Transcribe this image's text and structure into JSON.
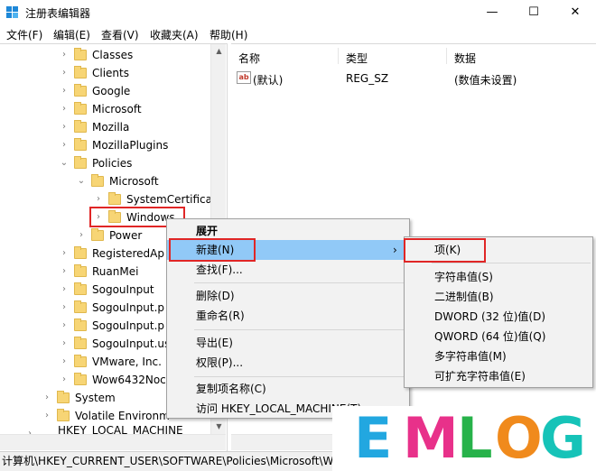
{
  "window": {
    "title": "注册表编辑器",
    "minimize_glyph": "—",
    "maximize_glyph": "☐",
    "close_glyph": "✕"
  },
  "menubar": [
    {
      "label": "文件(F)"
    },
    {
      "label": "编辑(E)"
    },
    {
      "label": "查看(V)"
    },
    {
      "label": "收藏夹(A)"
    },
    {
      "label": "帮助(H)"
    }
  ],
  "tree": [
    {
      "label": "Classes",
      "chevron": "›"
    },
    {
      "label": "Clients",
      "chevron": "›"
    },
    {
      "label": "Google",
      "chevron": "›"
    },
    {
      "label": "Microsoft",
      "chevron": "›"
    },
    {
      "label": "Mozilla",
      "chevron": "›"
    },
    {
      "label": "MozillaPlugins",
      "chevron": "›"
    },
    {
      "label": "Policies",
      "chevron": "⌄"
    },
    {
      "label": "Microsoft",
      "chevron": "⌄"
    },
    {
      "label": "SystemCertificat",
      "chevron": "›"
    },
    {
      "label": "Windows",
      "chevron": "›"
    },
    {
      "label": "Power",
      "chevron": "›"
    },
    {
      "label": "RegisteredAp",
      "chevron": "›"
    },
    {
      "label": "RuanMei",
      "chevron": "›"
    },
    {
      "label": "SogouInput",
      "chevron": "›"
    },
    {
      "label": "SogouInput.p",
      "chevron": "›"
    },
    {
      "label": "SogouInput.p",
      "chevron": "›"
    },
    {
      "label": "SogouInput.us",
      "chevron": "›"
    },
    {
      "label": "VMware, Inc.",
      "chevron": "›"
    },
    {
      "label": "Wow6432Noc",
      "chevron": "›"
    },
    {
      "label": "System",
      "chevron": "›"
    },
    {
      "label": "Volatile Environm",
      "chevron": "›"
    },
    {
      "label": "HKEY_LOCAL_MACHINE",
      "chevron": "›"
    }
  ],
  "list": {
    "columns": [
      "名称",
      "类型",
      "数据"
    ],
    "rows": [
      {
        "icon": "ab",
        "name": "(默认)",
        "type": "REG_SZ",
        "data": "(数值未设置)"
      }
    ]
  },
  "context_menu": {
    "items": [
      {
        "label": "展开",
        "bold": true
      },
      {
        "label": "新建(N)",
        "arrow": "›"
      },
      {
        "label": "查找(F)..."
      },
      {
        "label": "删除(D)"
      },
      {
        "label": "重命名(R)"
      },
      {
        "label": "导出(E)"
      },
      {
        "label": "权限(P)..."
      },
      {
        "label": "复制项名称(C)"
      },
      {
        "label": "访问 HKEY_LOCAL_MACHINE(T)"
      }
    ]
  },
  "submenu": {
    "items": [
      {
        "label": "项(K)"
      },
      {
        "label": "字符串值(S)"
      },
      {
        "label": "二进制值(B)"
      },
      {
        "label": "DWORD (32 位)值(D)"
      },
      {
        "label": "QWORD (64 位)值(Q)"
      },
      {
        "label": "多字符串值(M)"
      },
      {
        "label": "可扩充字符串值(E)"
      }
    ]
  },
  "statusbar": {
    "path": "计算机\\HKEY_CURRENT_USER\\SOFTWARE\\Policies\\Microsoft\\Windows"
  },
  "watermark": {
    "letters": [
      "E",
      "M",
      "L",
      "O",
      "G"
    ],
    "colors": [
      "#22a7e0",
      "#e8318a",
      "#27b24a",
      "#f08a1c",
      "#16c3b8"
    ]
  },
  "colors": {
    "highlight": "#91c9f7",
    "annotation_red": "#e02626",
    "folder": "#f7d575"
  }
}
